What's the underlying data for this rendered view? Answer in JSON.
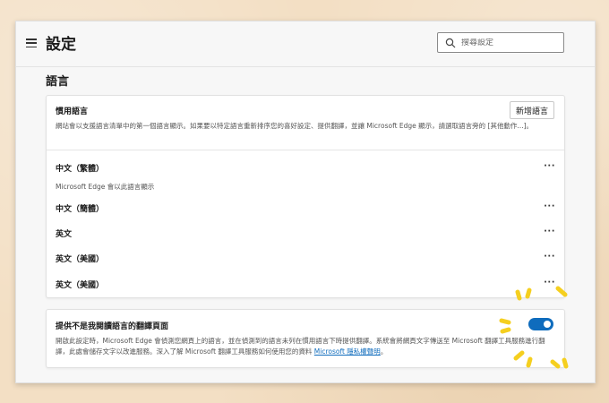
{
  "header": {
    "title": "設定",
    "search_placeholder": "搜尋設定"
  },
  "section": {
    "heading": "語言"
  },
  "preferred": {
    "title": "慣用語言",
    "description": "網站會以支援語言清單中的第一個語言顯示。如果要以特定語言重新排序您的喜好設定、提供翻譯，並讓 Microsoft Edge 顯示，請選取語言旁的 [其他動作...]。",
    "add_button": "新增語言"
  },
  "languages": [
    {
      "name": "中文（繁體）",
      "note": "Microsoft Edge 會以此語言顯示",
      "more": "···"
    },
    {
      "name": "中文（簡體）",
      "more": "···"
    },
    {
      "name": "英文",
      "more": "···"
    },
    {
      "name": "英文（美國）",
      "more": "···"
    },
    {
      "name": "英文（美國）",
      "more": "···"
    }
  ],
  "translate": {
    "title": "提供不是我閱讀語言的翻譯頁面",
    "description": "開啟此設定時，Microsoft Edge 會偵測您網頁上的語言，並在偵測到的語言未列在慣用語言下時提供翻譯。系統會將網頁文字傳送至 Microsoft 翻譯工具服務進行翻譯，此處會儲存文字以改進服務。深入了解 Microsoft 翻譯工具服務如何使用您的資料",
    "link_text": "Microsoft 隱私權聲明",
    "link_suffix": "。",
    "toggle_on": true
  },
  "colors": {
    "accent": "#0f6cbd",
    "background": "#f3dfc4",
    "sparkle": "#f5cf1f"
  }
}
